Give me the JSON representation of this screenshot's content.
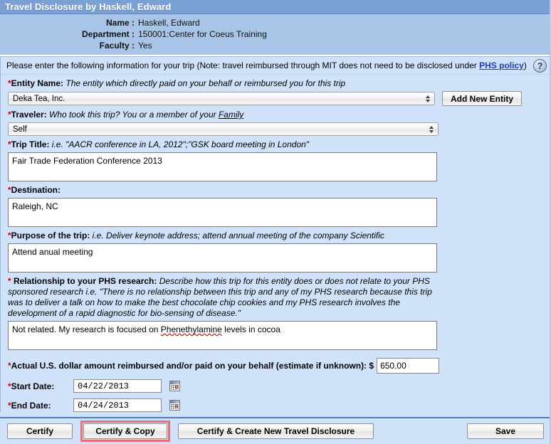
{
  "window": {
    "title": "Travel Disclosure by Haskell, Edward",
    "accent_title_bar": "#7ba0d4",
    "accent_info_panel": "#a8c4e6",
    "accent_form_bg": "#cfe2fa",
    "accent_required_star": "#cc0000",
    "accent_link": "#1a3fc4",
    "accent_highlight": "#ef6e73"
  },
  "person": {
    "rows": [
      {
        "label": "Name :",
        "value": "Haskell, Edward"
      },
      {
        "label": "Department :",
        "value": "150001:Center for Coeus Training"
      },
      {
        "label": "Faculty :",
        "value": "Yes"
      }
    ]
  },
  "note": {
    "text_before_link": "Please enter the following information for your trip (Note: travel reimbursed through MIT does not need to be disclosed under ",
    "link_label": "PHS policy",
    "text_after_link": ")",
    "help_icon": "question-mark-icon",
    "help_glyph": "?"
  },
  "fields": {
    "entity_name": {
      "star": "*",
      "label": "Entity Name:",
      "hint": " The entity which directly paid on your behalf or reimbursed you for this trip",
      "selected_value": "Deka Tea, Inc.",
      "add_button_label": "Add New Entity"
    },
    "traveler": {
      "star": "*",
      "label": "Traveler:",
      "hint": " Who took this trip? You or a member of your ",
      "hint_underlined": "Family",
      "selected_value": "Self"
    },
    "trip_title": {
      "star": "*",
      "label": "Trip Title:",
      "hint": " i.e. \"AACR conference in LA, 2012\";\"GSK board meeting in London\"",
      "value": "Fair Trade Federation Conference 2013"
    },
    "destination": {
      "star": "*",
      "label": "Destination:",
      "hint": "",
      "value": "Raleigh, NC"
    },
    "purpose": {
      "star": "*",
      "label": "Purpose of the trip:",
      "hint": " i.e. Deliver keynote address; attend annual meeting of the company Scientific",
      "value": "Attend anual meeting"
    },
    "relationship": {
      "star": "*",
      "label": " Relationship to your PHS research:",
      "hint": " Describe how this trip for this entity does or does not relate to your PHS sponsored research i.e. \"There is no relationship between this trip and any of my PHS research because this trip was to deliver a talk on how to make the best chocolate chip cookies and my PHS research involves the development of a rapid diagnostic for bio-sensing of disease.\"",
      "value_prefix": "Not related. My research is focused on ",
      "value_misspelled": "Phenethylamine",
      "value_suffix": " levels in cocoa"
    },
    "amount": {
      "star": "*",
      "label": "Actual U.S. dollar amount reimbursed and/or paid on your behalf (estimate if unknown): $",
      "value": "650.00"
    },
    "start_date": {
      "star": "*",
      "label": "Start Date:",
      "value": "04/22/2013",
      "picker_icon": "calendar-icon"
    },
    "end_date": {
      "star": "*",
      "label": "End Date:",
      "value": "04/24/2013",
      "picker_icon": "calendar-icon"
    }
  },
  "footer": {
    "certify_label": "Certify",
    "certify_copy_label": "Certify & Copy",
    "certify_create_label": "Certify & Create  New Travel Disclosure",
    "save_label": "Save"
  }
}
